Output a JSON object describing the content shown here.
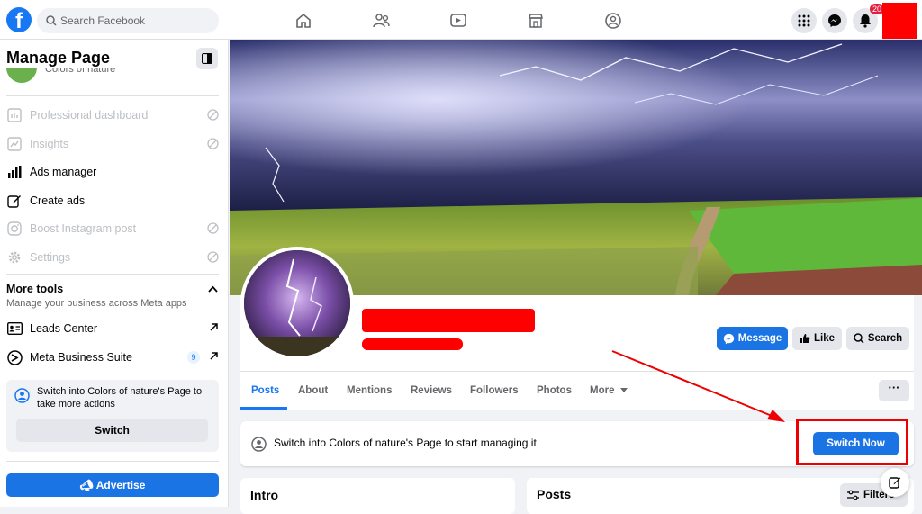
{
  "topbar": {
    "logo": "f",
    "search_placeholder": "Search Facebook",
    "nav_icons": [
      "home-icon",
      "friends-icon",
      "watch-icon",
      "marketplace-icon",
      "groups-icon"
    ],
    "notification_count": "20"
  },
  "sidebar": {
    "title": "Manage Page",
    "page_name": "Colors of nature",
    "items": [
      {
        "label": "Professional dashboard",
        "icon": "dashboard-icon",
        "enabled": false
      },
      {
        "label": "Insights",
        "icon": "insights-icon",
        "enabled": false
      },
      {
        "label": "Ads manager",
        "icon": "bar-chart-icon",
        "enabled": true
      },
      {
        "label": "Create ads",
        "icon": "edit-icon",
        "enabled": true
      },
      {
        "label": "Boost Instagram post",
        "icon": "instagram-icon",
        "enabled": false
      },
      {
        "label": "Settings",
        "icon": "gear-icon",
        "enabled": false
      }
    ],
    "tools_heading": "More tools",
    "tools_sub": "Manage your business across Meta apps",
    "tools": [
      {
        "label": "Leads Center",
        "icon": "id-card-icon"
      },
      {
        "label": "Meta Business Suite",
        "icon": "meta-icon",
        "badge": "9"
      }
    ],
    "switch_card_text": "Switch into Colors of nature's Page to take more actions",
    "switch_button": "Switch",
    "advertise_button": "Advertise"
  },
  "profile": {
    "actions": {
      "message": "Message",
      "like": "Like",
      "search": "Search"
    },
    "tabs": [
      "Posts",
      "About",
      "Mentions",
      "Reviews",
      "Followers",
      "Photos",
      "More"
    ],
    "more_button": "···"
  },
  "notice": {
    "text": "Switch into Colors of nature's Page to start managing it.",
    "button": "Switch Now"
  },
  "intro": {
    "title": "Intro"
  },
  "posts": {
    "title": "Posts",
    "filters": "Filters"
  },
  "colors": {
    "accent": "#1877f2",
    "button_blue": "#1b74e4",
    "annotation_red": "#ee0000"
  }
}
